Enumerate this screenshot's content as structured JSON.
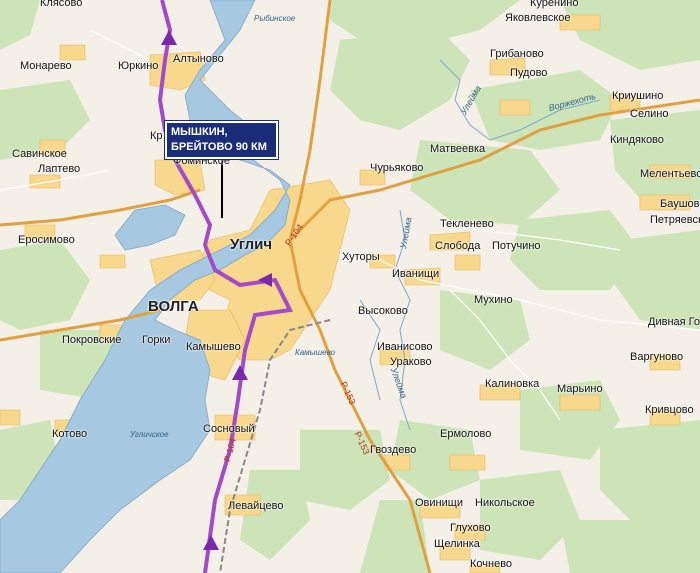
{
  "map": {
    "city": "Углич",
    "river_label": "ВОЛГА",
    "sign": {
      "line1": "МЫШКИН,",
      "line2": "БРЕЙТОВО 90 КМ"
    },
    "water_labels": {
      "rybinsk": "Рыбинское",
      "uglich": "Угличское"
    },
    "river_labels": {
      "uletma1": "Улейма",
      "uletma2": "Улейма",
      "uletma3": "Улейма",
      "vozhehot": "Воржехоть"
    },
    "road_labels": {
      "r104_north": "Р-104",
      "r104_south": "Р-104",
      "r153a": "Р-153",
      "r153b": "Р-153",
      "kamyshevo_rail": "Камышево"
    },
    "villages": {
      "klyasovo": "Клясово",
      "kurenino": "Куренино",
      "yakovlevskoe": "Яковлевское",
      "monarevo": "Монарево",
      "yurkino": "Юркино",
      "altynovo": "Алтыново",
      "gribanovo": "Грибаново",
      "pudovo": "Пудово",
      "kriushino": "Криушино",
      "selino": "Селино",
      "kindyakovo": "Киндяково",
      "savinskoe": "Савинское",
      "laptevo": "Лаптево",
      "matveevka": "Матвеевка",
      "churyakovo": "Чурьяково",
      "melentevo": "Мелентьево",
      "baushovo": "Баушово",
      "petryaevskoe": "Петряевское",
      "kr": "Кр",
      "fominskoe": "Фоминское",
      "teklenevo": "Текленево",
      "sloboda": "Слобода",
      "potuchino": "Потучино",
      "erosimovo": "Еросимово",
      "khutory": "Хуторы",
      "ivanishchi": "Иванищи",
      "mukhino": "Мухино",
      "divnaya_gora": "Дивная Го",
      "pokrovskie": "Покровские",
      "gorki": "Горки",
      "kamyshevo": "Камышево",
      "vysokovo": "Высоково",
      "ivanisovo": "Иванисово",
      "urakovo": "Ураково",
      "vargunovo": "Варгуново",
      "kalinovka": "Калиновка",
      "maryino": "Марьино",
      "kotovo": "Котово",
      "sosnovy": "Сосновый",
      "ermolovo": "Ермолово",
      "krivtsovo": "Кривцово",
      "gvozdevo": "Гвоздево",
      "levaytsevo": "Левайцево",
      "ovinishchi": "Овинищи",
      "nikolskoe": "Никольское",
      "glukhovo": "Глухово",
      "shchelinka": "Щелинка",
      "kochnevo": "Кочнево"
    }
  }
}
